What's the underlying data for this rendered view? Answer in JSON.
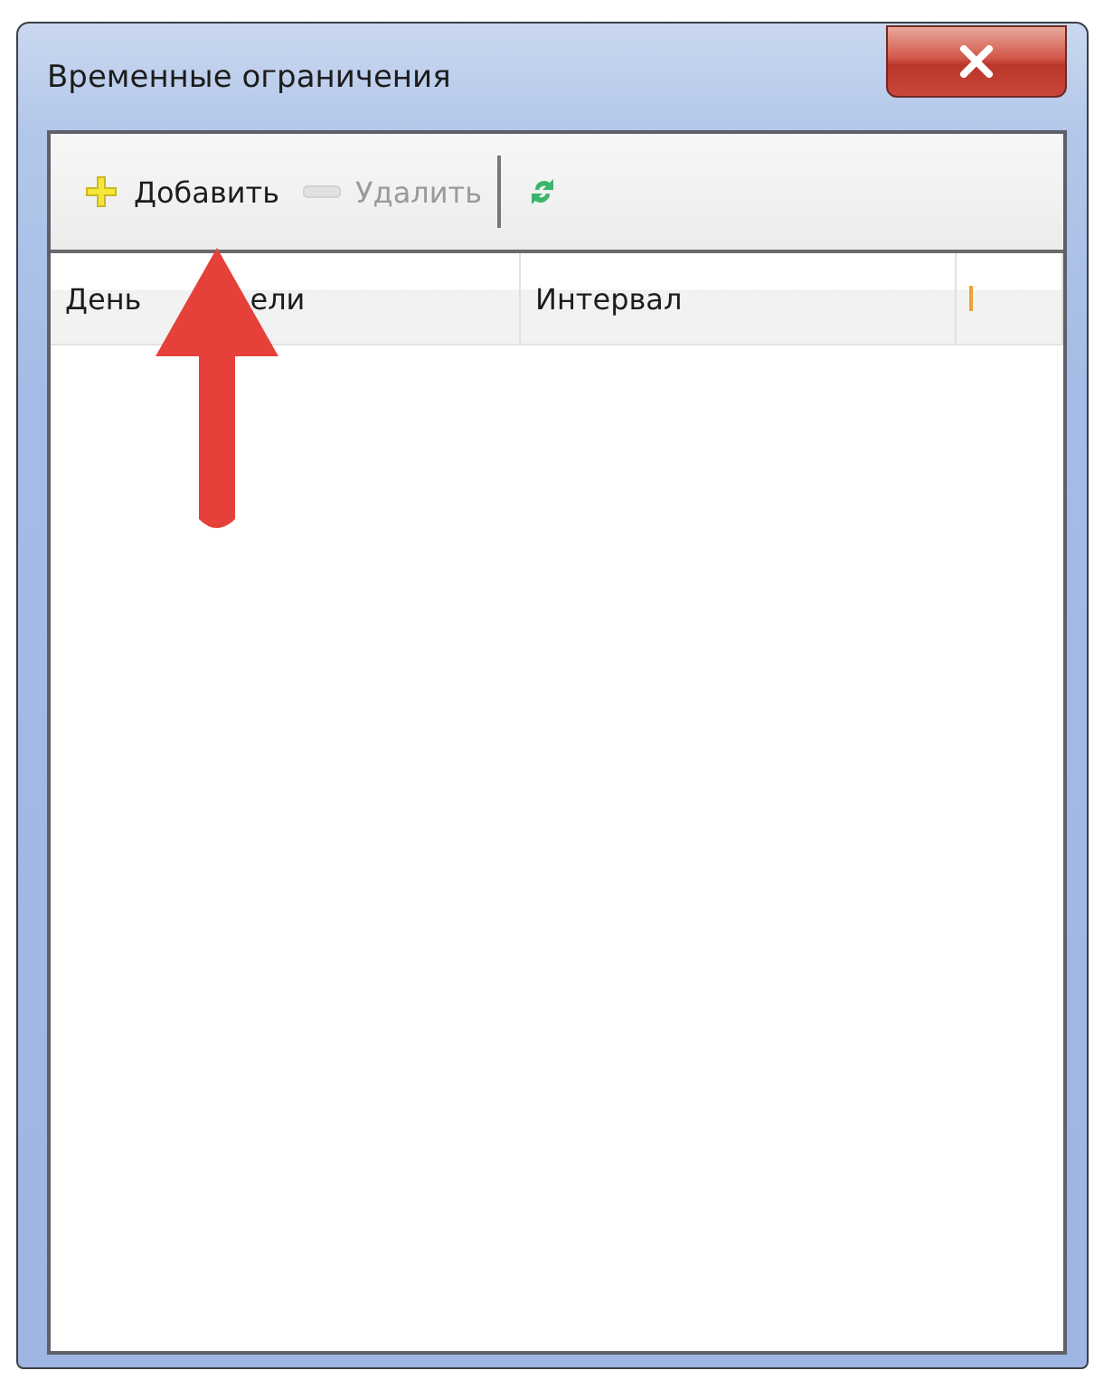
{
  "window": {
    "title": "Временные ограничения"
  },
  "toolbar": [
    {
      "kind": "add",
      "label": "Добавить",
      "disabled": false
    },
    {
      "kind": "delete",
      "label": "Удалить",
      "disabled": true
    },
    {
      "kind": "refresh",
      "disabled": false
    }
  ],
  "table": {
    "columns": [
      {
        "visible_parts": [
          "День",
          "ели"
        ]
      },
      {
        "visible_parts": [
          "Интервал"
        ]
      },
      {
        "kind": "marker"
      }
    ]
  }
}
